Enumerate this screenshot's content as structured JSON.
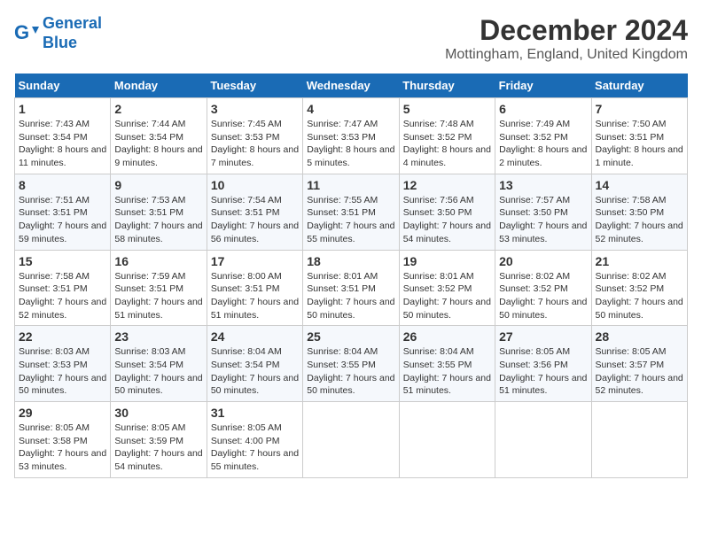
{
  "logo": {
    "line1": "General",
    "line2": "Blue"
  },
  "title": "December 2024",
  "subtitle": "Mottingham, England, United Kingdom",
  "days_of_week": [
    "Sunday",
    "Monday",
    "Tuesday",
    "Wednesday",
    "Thursday",
    "Friday",
    "Saturday"
  ],
  "weeks": [
    [
      {
        "day": "1",
        "sunrise": "7:43 AM",
        "sunset": "3:54 PM",
        "daylight": "8 hours and 11 minutes."
      },
      {
        "day": "2",
        "sunrise": "7:44 AM",
        "sunset": "3:54 PM",
        "daylight": "8 hours and 9 minutes."
      },
      {
        "day": "3",
        "sunrise": "7:45 AM",
        "sunset": "3:53 PM",
        "daylight": "8 hours and 7 minutes."
      },
      {
        "day": "4",
        "sunrise": "7:47 AM",
        "sunset": "3:53 PM",
        "daylight": "8 hours and 5 minutes."
      },
      {
        "day": "5",
        "sunrise": "7:48 AM",
        "sunset": "3:52 PM",
        "daylight": "8 hours and 4 minutes."
      },
      {
        "day": "6",
        "sunrise": "7:49 AM",
        "sunset": "3:52 PM",
        "daylight": "8 hours and 2 minutes."
      },
      {
        "day": "7",
        "sunrise": "7:50 AM",
        "sunset": "3:51 PM",
        "daylight": "8 hours and 1 minute."
      }
    ],
    [
      {
        "day": "8",
        "sunrise": "7:51 AM",
        "sunset": "3:51 PM",
        "daylight": "7 hours and 59 minutes."
      },
      {
        "day": "9",
        "sunrise": "7:53 AM",
        "sunset": "3:51 PM",
        "daylight": "7 hours and 58 minutes."
      },
      {
        "day": "10",
        "sunrise": "7:54 AM",
        "sunset": "3:51 PM",
        "daylight": "7 hours and 56 minutes."
      },
      {
        "day": "11",
        "sunrise": "7:55 AM",
        "sunset": "3:51 PM",
        "daylight": "7 hours and 55 minutes."
      },
      {
        "day": "12",
        "sunrise": "7:56 AM",
        "sunset": "3:50 PM",
        "daylight": "7 hours and 54 minutes."
      },
      {
        "day": "13",
        "sunrise": "7:57 AM",
        "sunset": "3:50 PM",
        "daylight": "7 hours and 53 minutes."
      },
      {
        "day": "14",
        "sunrise": "7:58 AM",
        "sunset": "3:50 PM",
        "daylight": "7 hours and 52 minutes."
      }
    ],
    [
      {
        "day": "15",
        "sunrise": "7:58 AM",
        "sunset": "3:51 PM",
        "daylight": "7 hours and 52 minutes."
      },
      {
        "day": "16",
        "sunrise": "7:59 AM",
        "sunset": "3:51 PM",
        "daylight": "7 hours and 51 minutes."
      },
      {
        "day": "17",
        "sunrise": "8:00 AM",
        "sunset": "3:51 PM",
        "daylight": "7 hours and 51 minutes."
      },
      {
        "day": "18",
        "sunrise": "8:01 AM",
        "sunset": "3:51 PM",
        "daylight": "7 hours and 50 minutes."
      },
      {
        "day": "19",
        "sunrise": "8:01 AM",
        "sunset": "3:52 PM",
        "daylight": "7 hours and 50 minutes."
      },
      {
        "day": "20",
        "sunrise": "8:02 AM",
        "sunset": "3:52 PM",
        "daylight": "7 hours and 50 minutes."
      },
      {
        "day": "21",
        "sunrise": "8:02 AM",
        "sunset": "3:52 PM",
        "daylight": "7 hours and 50 minutes."
      }
    ],
    [
      {
        "day": "22",
        "sunrise": "8:03 AM",
        "sunset": "3:53 PM",
        "daylight": "7 hours and 50 minutes."
      },
      {
        "day": "23",
        "sunrise": "8:03 AM",
        "sunset": "3:54 PM",
        "daylight": "7 hours and 50 minutes."
      },
      {
        "day": "24",
        "sunrise": "8:04 AM",
        "sunset": "3:54 PM",
        "daylight": "7 hours and 50 minutes."
      },
      {
        "day": "25",
        "sunrise": "8:04 AM",
        "sunset": "3:55 PM",
        "daylight": "7 hours and 50 minutes."
      },
      {
        "day": "26",
        "sunrise": "8:04 AM",
        "sunset": "3:55 PM",
        "daylight": "7 hours and 51 minutes."
      },
      {
        "day": "27",
        "sunrise": "8:05 AM",
        "sunset": "3:56 PM",
        "daylight": "7 hours and 51 minutes."
      },
      {
        "day": "28",
        "sunrise": "8:05 AM",
        "sunset": "3:57 PM",
        "daylight": "7 hours and 52 minutes."
      }
    ],
    [
      {
        "day": "29",
        "sunrise": "8:05 AM",
        "sunset": "3:58 PM",
        "daylight": "7 hours and 53 minutes."
      },
      {
        "day": "30",
        "sunrise": "8:05 AM",
        "sunset": "3:59 PM",
        "daylight": "7 hours and 54 minutes."
      },
      {
        "day": "31",
        "sunrise": "8:05 AM",
        "sunset": "4:00 PM",
        "daylight": "7 hours and 55 minutes."
      },
      null,
      null,
      null,
      null
    ]
  ]
}
